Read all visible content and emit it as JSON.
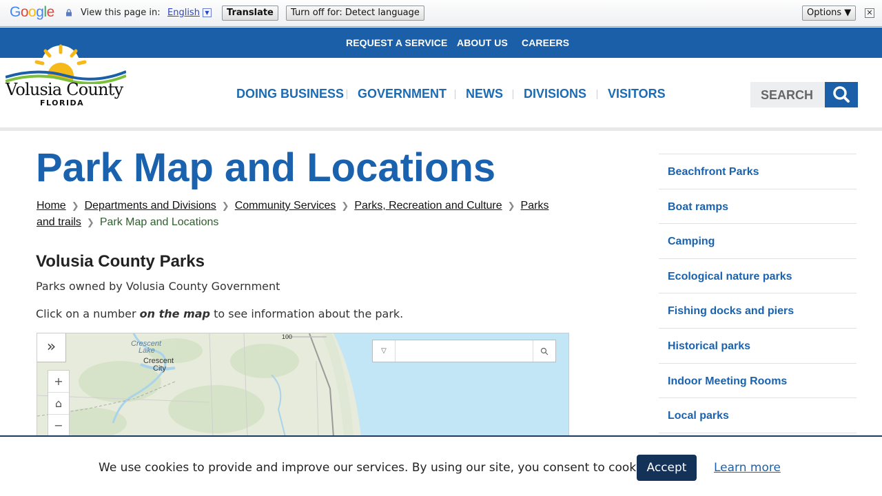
{
  "translate_bar": {
    "logo": "Google",
    "view_label": "View this page in:",
    "language": "English",
    "translate_button": "Translate",
    "turn_off_button": "Turn off for: Detect language",
    "options_button": "Options ▼",
    "close_glyph": "✕"
  },
  "top_nav": [
    "REQUEST A SERVICE",
    "ABOUT US",
    "CAREERS"
  ],
  "logo": {
    "name": "Volusia County",
    "state": "FLORIDA"
  },
  "main_nav": [
    "DOING BUSINESS",
    "GOVERNMENT",
    "NEWS",
    "DIVISIONS",
    "VISITORS"
  ],
  "search": {
    "label": "SEARCH"
  },
  "page": {
    "title": "Park Map and Locations",
    "breadcrumbs": [
      "Home",
      "Departments and Divisions",
      "Community Services",
      "Parks, Recreation and Culture",
      "Parks and trails"
    ],
    "breadcrumb_current": "Park Map and Locations",
    "heading": "Volusia County Parks",
    "subtitle": "Parks owned by Volusia County Government",
    "instruction_pre": "Click on a number ",
    "instruction_em": "on the map",
    "instruction_post": " to see information about the park."
  },
  "map": {
    "labels": {
      "crescent_lake": "Crescent",
      "crescent_lake_2": "Lake",
      "crescent_city": "Crescent",
      "crescent_city_2": "City",
      "road": "100"
    },
    "zoom_in": "+",
    "home": "⌂",
    "zoom_out": "−",
    "expand": "»"
  },
  "sidebar": [
    "Beachfront Parks",
    "Boat ramps",
    "Camping",
    "Ecological nature parks",
    "Fishing docks and piers",
    "Historical parks",
    "Indoor Meeting Rooms",
    "Local parks"
  ],
  "cookie": {
    "message": "We use cookies to provide and improve our services. By using our site, you consent to cookies.",
    "accept": "Accept",
    "learn_more": "Learn more"
  }
}
